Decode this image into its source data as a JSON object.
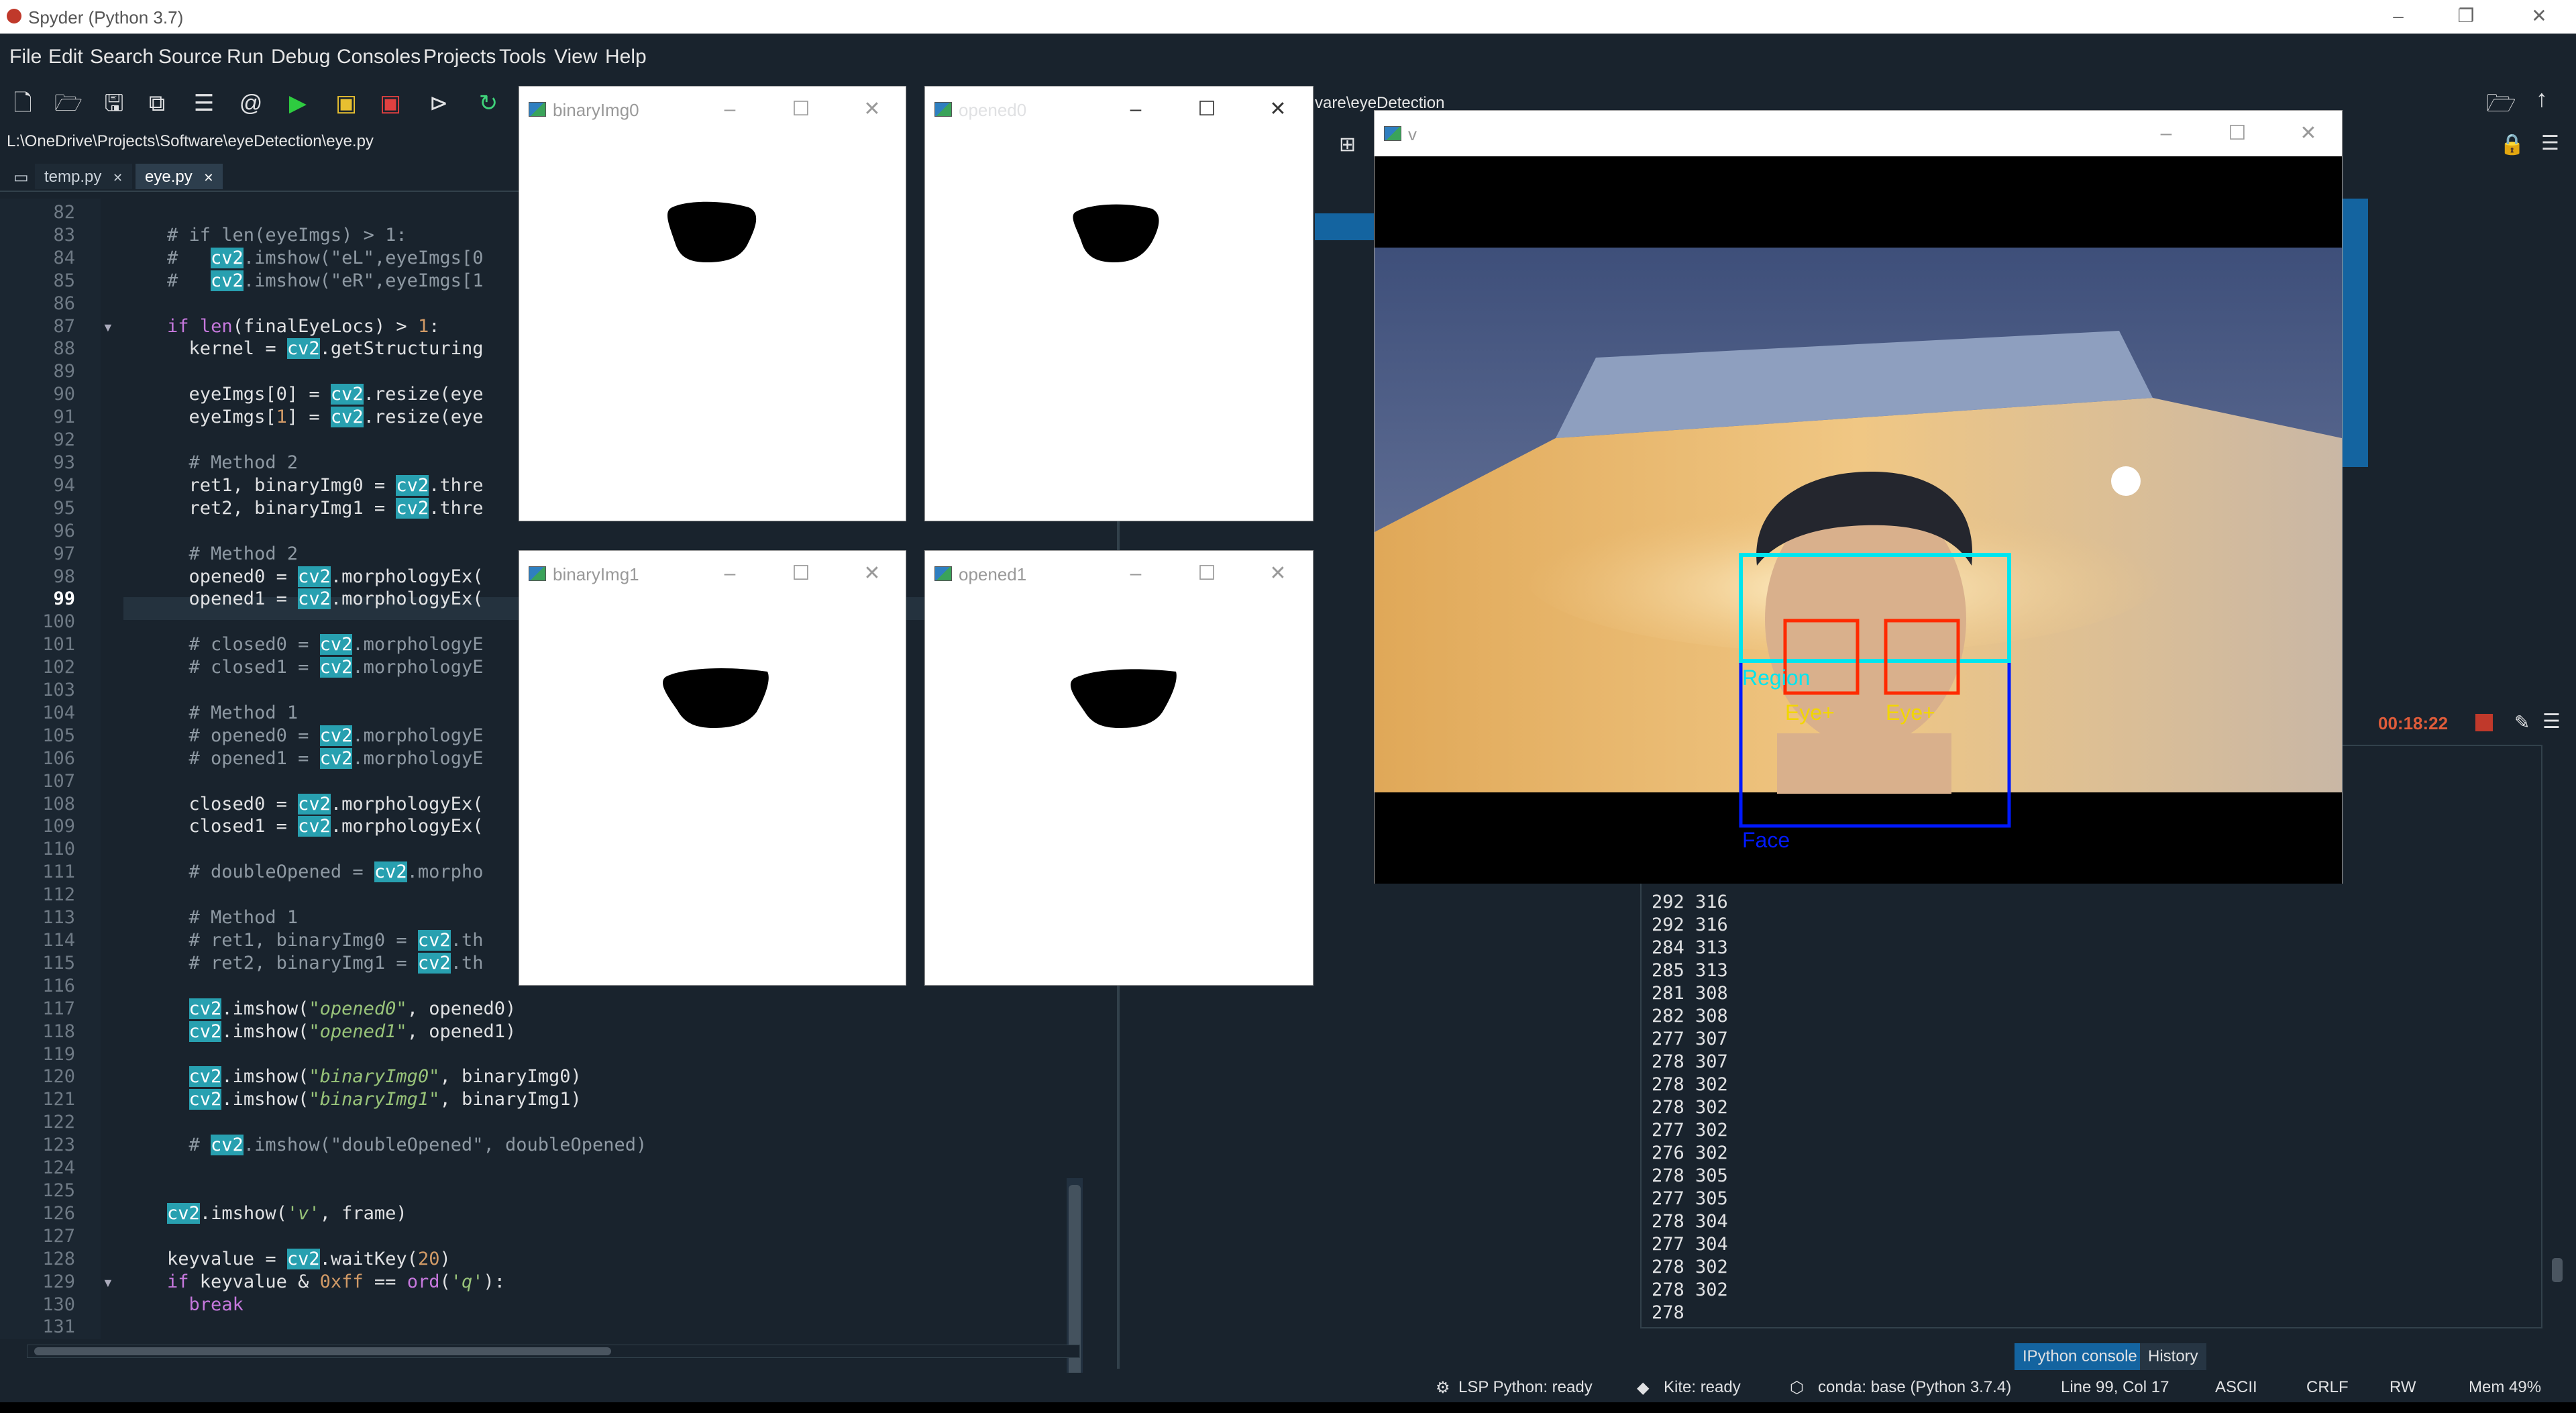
{
  "window": {
    "title": "Spyder (Python 3.7)",
    "controls": [
      "–",
      "❐",
      "✕"
    ]
  },
  "menu": [
    "File",
    "Edit",
    "Search",
    "Source",
    "Run",
    "Debug",
    "Consoles",
    "Projects",
    "Tools",
    "View",
    "Help"
  ],
  "editor": {
    "path": "L:\\OneDrive\\Projects\\Software\\eyeDetection\\eye.py",
    "tabs": [
      {
        "label": "temp.py",
        "close": "✕"
      },
      {
        "label": "eye.py",
        "close": "✕"
      }
    ],
    "current_line": "99",
    "lines": [
      {
        "n": "82",
        "t": ""
      },
      {
        "n": "83",
        "t": "    # if len(eyeImgs) > 1:"
      },
      {
        "n": "84",
        "t": "    #   cv2.imshow(\"eL\",eyeImgs[0"
      },
      {
        "n": "85",
        "t": "    #   cv2.imshow(\"eR\",eyeImgs[1"
      },
      {
        "n": "86",
        "t": ""
      },
      {
        "n": "87",
        "t": "    if len(finalEyeLocs) > 1:"
      },
      {
        "n": "88",
        "t": "      kernel = cv2.getStructuring"
      },
      {
        "n": "89",
        "t": ""
      },
      {
        "n": "90",
        "t": "      eyeImgs[0] = cv2.resize(eye"
      },
      {
        "n": "91",
        "t": "      eyeImgs[1] = cv2.resize(eye"
      },
      {
        "n": "92",
        "t": ""
      },
      {
        "n": "93",
        "t": "      # Method 2"
      },
      {
        "n": "94",
        "t": "      ret1, binaryImg0 = cv2.thre"
      },
      {
        "n": "95",
        "t": "      ret2, binaryImg1 = cv2.thre"
      },
      {
        "n": "96",
        "t": ""
      },
      {
        "n": "97",
        "t": "      # Method 2"
      },
      {
        "n": "98",
        "t": "      opened0 = cv2.morphologyEx("
      },
      {
        "n": "99",
        "t": "      opened1 = cv2.morphologyEx("
      },
      {
        "n": "100",
        "t": ""
      },
      {
        "n": "101",
        "t": "      # closed0 = cv2.morphologyE"
      },
      {
        "n": "102",
        "t": "      # closed1 = cv2.morphologyE"
      },
      {
        "n": "103",
        "t": ""
      },
      {
        "n": "104",
        "t": "      # Method 1"
      },
      {
        "n": "105",
        "t": "      # opened0 = cv2.morphologyE"
      },
      {
        "n": "106",
        "t": "      # opened1 = cv2.morphologyE"
      },
      {
        "n": "107",
        "t": ""
      },
      {
        "n": "108",
        "t": "      closed0 = cv2.morphologyEx("
      },
      {
        "n": "109",
        "t": "      closed1 = cv2.morphologyEx("
      },
      {
        "n": "110",
        "t": ""
      },
      {
        "n": "111",
        "t": "      # doubleOpened = cv2.morpho"
      },
      {
        "n": "112",
        "t": ""
      },
      {
        "n": "113",
        "t": "      # Method 1"
      },
      {
        "n": "114",
        "t": "      # ret1, binaryImg0 = cv2.th"
      },
      {
        "n": "115",
        "t": "      # ret2, binaryImg1 = cv2.th"
      },
      {
        "n": "116",
        "t": ""
      },
      {
        "n": "117",
        "t": "      cv2.imshow(\"opened0\", opened0)"
      },
      {
        "n": "118",
        "t": "      cv2.imshow(\"opened1\", opened1)"
      },
      {
        "n": "119",
        "t": ""
      },
      {
        "n": "120",
        "t": "      cv2.imshow(\"binaryImg0\", binaryImg0)"
      },
      {
        "n": "121",
        "t": "      cv2.imshow(\"binaryImg1\", binaryImg1)"
      },
      {
        "n": "122",
        "t": ""
      },
      {
        "n": "123",
        "t": "      # cv2.imshow(\"doubleOpened\", doubleOpened)"
      },
      {
        "n": "124",
        "t": ""
      },
      {
        "n": "125",
        "t": ""
      },
      {
        "n": "126",
        "t": "    cv2.imshow('v', frame)"
      },
      {
        "n": "127",
        "t": ""
      },
      {
        "n": "128",
        "t": "    keyvalue = cv2.waitKey(20)"
      },
      {
        "n": "129",
        "t": "    if keyvalue & 0xff == ord('q'):"
      },
      {
        "n": "130",
        "t": "      break"
      },
      {
        "n": "131",
        "t": ""
      }
    ]
  },
  "right_path": "vare\\eyeDetection",
  "console": {
    "timer": "00:18:22",
    "lines": [
      "292 316",
      "292 316",
      "284 313",
      "285 313",
      "281 308",
      "282 308",
      "277 307",
      "278 307",
      "278 302",
      "278 302",
      "277 302",
      "276 302",
      "278 305",
      "277 305",
      "278 304",
      "277 304",
      "278 302",
      "278 302",
      "278"
    ],
    "tabs": [
      "IPython console",
      "History"
    ]
  },
  "status": {
    "lsp": "LSP Python: ready",
    "kite": "Kite: ready",
    "conda": "conda: base (Python 3.7.4)",
    "position": "Line 99, Col 17",
    "encoding": "ASCII",
    "eol": "CRLF",
    "rw": "RW",
    "mem": "Mem 49%"
  },
  "cv_windows": {
    "binaryImg0": {
      "title": "binaryImg0"
    },
    "opened0": {
      "title": "opened0"
    },
    "binaryImg1": {
      "title": "binaryImg1"
    },
    "opened1": {
      "title": "opened1"
    },
    "video": {
      "title": "v",
      "labels": {
        "region": "Region",
        "eye_left": "Eye+",
        "eye_right": "Eye+",
        "face": "Face"
      }
    },
    "controls": [
      "–",
      "☐",
      "✕"
    ]
  },
  "colors": {
    "ide_bg": "#19232d",
    "accent": "#1464a0",
    "region_box": "#00e5ee",
    "eye_box": "#ff2a00",
    "face_box": "#0019ff",
    "eye_label": "#f2d600"
  },
  "icons": [
    "new-file-icon",
    "open-folder-icon",
    "save-icon",
    "save-all-icon",
    "outline-icon",
    "at-sign-icon",
    "run-icon",
    "run-cell-icon",
    "run-cell-advance-icon",
    "run-selection-icon",
    "rerun-icon"
  ]
}
